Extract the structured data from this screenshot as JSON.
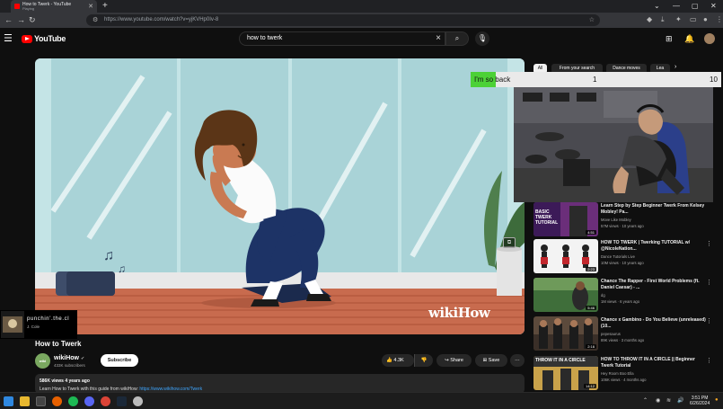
{
  "browser": {
    "tab_title": "How to Twerk - YouTube",
    "tab_subtitle": "Playing",
    "url": "https://www.youtube.com/watch?v=yjKVHp0Iv-8"
  },
  "header": {
    "logo_text": "YouTube",
    "search_value": "how to twerk"
  },
  "video": {
    "title": "How to Twerk",
    "watermark_wiki": "wiki",
    "watermark_how": "How",
    "channel_name": "wikiHow",
    "channel_avatar_text": "wiki How",
    "channel_subs": "433K subscribers",
    "subscribe_label": "Subscribe",
    "likes": "4.3K",
    "share_label": "Share",
    "save_label": "Save",
    "desc_meta": "586K views  4 years ago",
    "desc_text": "Learn How to Twerk with this guide from wikiHow:",
    "desc_link": "https://www.wikihow.com/Twerk"
  },
  "now_playing": {
    "title": "punchin'.the.cl",
    "artist": "J. Cole"
  },
  "chips": [
    "All",
    "From your search",
    "Dance moves",
    "Lea"
  ],
  "counter": {
    "label": "I'm so back",
    "current": "1",
    "max": "10",
    "progress": 0.1
  },
  "recommendations": [
    {
      "title": "Learn Step by Step Beginner Twerk From Kelsey Mobley! Pa...",
      "channel": "Move Like Mobley",
      "meta": "57M views  ·  10 years ago",
      "duration": "4:51",
      "thumb_text": "BASIC TWERK TUTORIAL"
    },
    {
      "title": "HOW TO TWERK | Twerking TUTORIAL w/ @NicoleNation...",
      "channel": "Dance Tutorials Live",
      "meta": "10M views  ·  10 years ago",
      "duration": "2:23",
      "thumb_text": ""
    },
    {
      "title": "Chance The Rapper - First World Problems (ft. Daniel Caesar) - ...",
      "channel": "dg",
      "meta": "1M views  ·  6 years ago",
      "duration": "5:46",
      "thumb_text": ""
    },
    {
      "title": "Chance x Gambino - Do You Believe (unreleased) (10...",
      "channel": "pepesaurus",
      "meta": "89K views  ·  3 months ago",
      "duration": "2:16",
      "thumb_text": ""
    },
    {
      "title": "HOW TO THROW IT IN A CIRCLE || Beginner Twerk Tutorial",
      "channel": "Hey Room Boo Ella",
      "meta": "106K views  ·  4 months ago",
      "duration": "14:12",
      "thumb_text": "THROW IT IN A CIRCLE"
    }
  ],
  "taskbar": {
    "time": "3:51 PM",
    "date": "6/26/2024"
  }
}
